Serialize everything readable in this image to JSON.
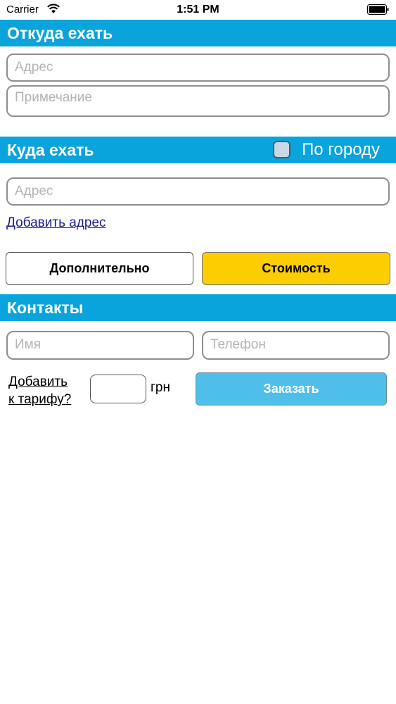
{
  "status_bar": {
    "carrier": "Carrier",
    "time": "1:51 PM"
  },
  "from_section": {
    "title": "Откуда ехать",
    "address_placeholder": "Адрес",
    "note_placeholder": "Примечание"
  },
  "to_section": {
    "title": "Куда ехать",
    "city_checkbox_label": "По городу",
    "address_placeholder": "Адрес",
    "add_address_link": "Добавить адрес"
  },
  "actions": {
    "extra_button": "Дополнительно",
    "cost_button": "Стоимость"
  },
  "contacts_section": {
    "title": "Контакты",
    "name_placeholder": "Имя",
    "phone_placeholder": "Телефон",
    "add_to_tariff_line1": "Добавить",
    "add_to_tariff_line2": "к тарифу?",
    "currency": "грн",
    "order_button": "Заказать"
  },
  "colors": {
    "header_blue": "#0aa4dc",
    "cost_yellow": "#fccd00",
    "order_blue": "#4fbfe9"
  }
}
